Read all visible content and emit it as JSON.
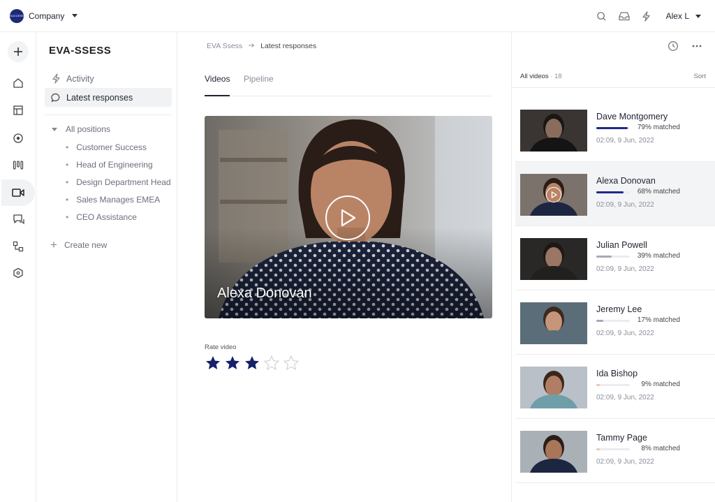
{
  "topbar": {
    "company_logo_text": "SUCCESS",
    "company_name": "Company",
    "user_name": "Alex L"
  },
  "sidebar": {
    "brand": "EVA-SSESS",
    "activity": "Activity",
    "latest_responses": "Latest responses",
    "all_positions": "All positions",
    "positions": [
      "Customer Success",
      "Head of Engineering",
      "Design Department Head",
      "Sales Manages EMEA",
      "CEO Assistance"
    ],
    "create_new": "Create new"
  },
  "breadcrumb": {
    "root": "EVA Ssess",
    "current": "Latest responses"
  },
  "tabs": {
    "videos": "Videos",
    "pipeline": "Pipeline"
  },
  "video": {
    "candidate": "Alexa Donovan"
  },
  "rating": {
    "label": "Rate video",
    "value": 3,
    "max": 5
  },
  "videos_panel": {
    "label": "All videos",
    "count": "· 18",
    "sort": "Sort",
    "items": [
      {
        "name": "Dave Montgomery",
        "match": 0.79,
        "match_text": "79% matched",
        "date": "02:09, 9 Jun, 2022",
        "color": "#1d2a8a"
      },
      {
        "name": "Alexa Donovan",
        "match": 0.68,
        "match_text": "68% matched",
        "date": "02:09, 9 Jun, 2022",
        "color": "#1d2a8a"
      },
      {
        "name": "Julian Powell",
        "match": 0.39,
        "match_text": "39% matched",
        "date": "02:09, 9 Jun, 2022",
        "color": "#a8a8b8"
      },
      {
        "name": "Jeremy Lee",
        "match": 0.17,
        "match_text": "17% matched",
        "date": "02:09, 9 Jun, 2022",
        "color": "#a8a8b8"
      },
      {
        "name": "Ida Bishop",
        "match": 0.09,
        "match_text": "9% matched",
        "date": "02:09, 9 Jun, 2022",
        "color": "#f4c89a"
      },
      {
        "name": "Tammy Page",
        "match": 0.08,
        "match_text": "8% matched",
        "date": "02:09, 9 Jun, 2022",
        "color": "#f4c89a"
      }
    ]
  }
}
